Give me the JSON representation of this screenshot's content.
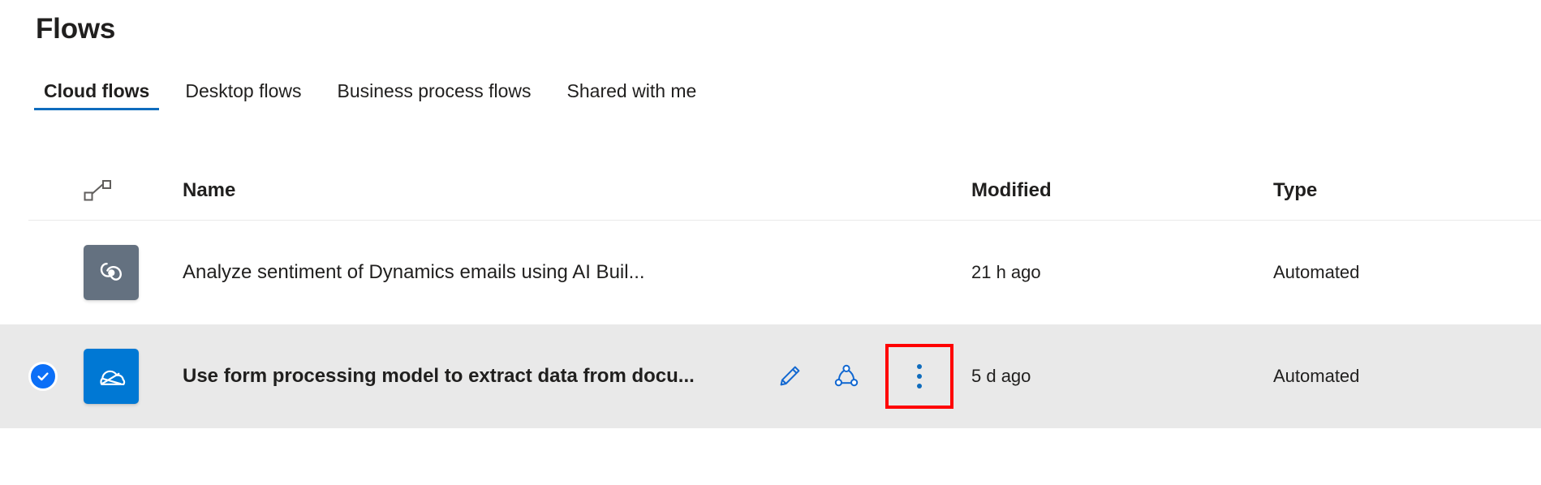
{
  "page": {
    "title": "Flows"
  },
  "tabs": [
    {
      "label": "Cloud flows",
      "active": true
    },
    {
      "label": "Desktop flows",
      "active": false
    },
    {
      "label": "Business process flows",
      "active": false
    },
    {
      "label": "Shared with me",
      "active": false
    }
  ],
  "table": {
    "columns": {
      "flow_icon": "flow-icon",
      "name": "Name",
      "modified": "Modified",
      "type": "Type"
    },
    "rows": [
      {
        "selected": false,
        "icon": "ai-builder-icon",
        "icon_color": "#647180",
        "name": "Analyze sentiment of Dynamics emails using AI Buil...",
        "modified": "21 h ago",
        "type": "Automated"
      },
      {
        "selected": true,
        "icon": "onedrive-cloud-icon",
        "icon_color": "#0078d4",
        "name": "Use form processing model to extract data from docu...",
        "modified": "5 d ago",
        "type": "Automated"
      }
    ]
  },
  "row_actions": {
    "edit": "edit-pencil-icon",
    "share": "share-icon",
    "more": "more-commands-icon"
  },
  "annotation": {
    "highlight_color": "#ff0000",
    "target": "more-commands-icon"
  },
  "colors": {
    "accent": "#0f6cbd",
    "selected_row_bg": "#e9e9e9",
    "checkbox": "#0b6ff7"
  }
}
